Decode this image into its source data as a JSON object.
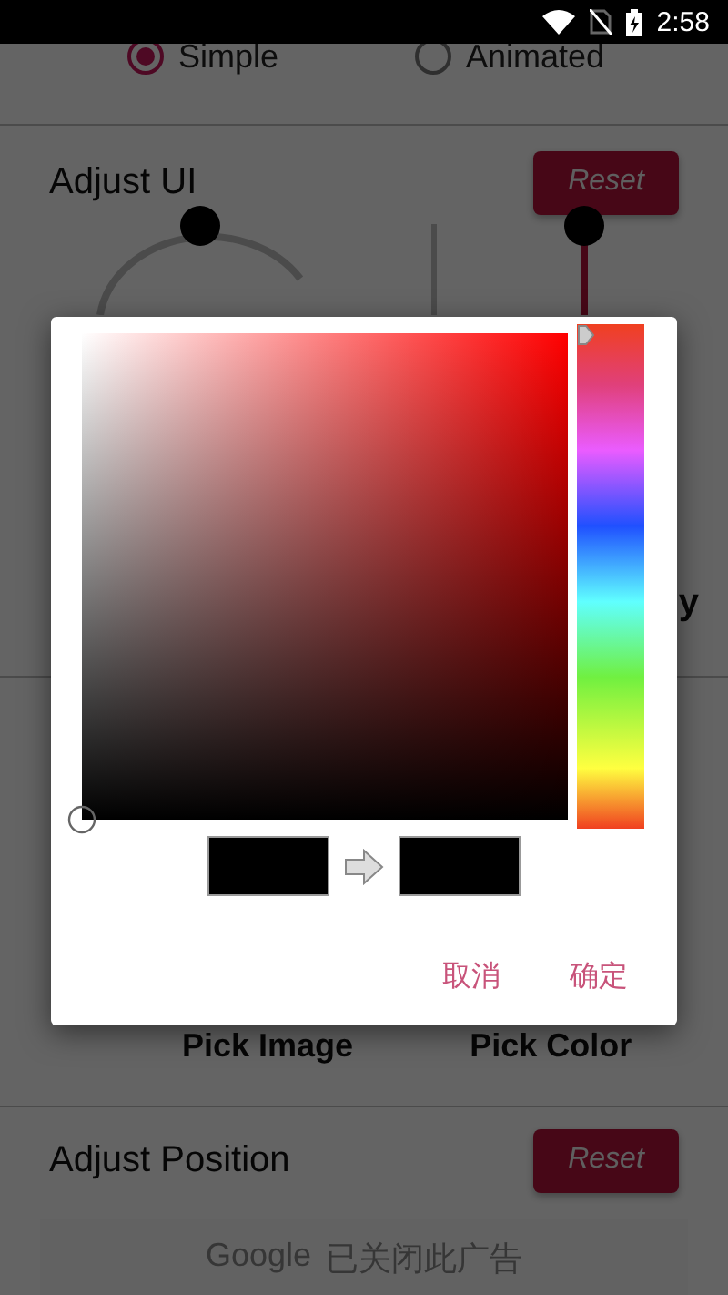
{
  "status_bar": {
    "time": "2:58"
  },
  "mode_options": [
    {
      "label": "Simple",
      "selected": true
    },
    {
      "label": "Animated",
      "selected": false
    }
  ],
  "adjust_ui": {
    "title": "Adjust UI",
    "reset_label": "Reset",
    "side_label_fragment": "y"
  },
  "pick_buttons": [
    {
      "label": "Pick Image"
    },
    {
      "label": "Pick Color"
    }
  ],
  "adjust_position": {
    "title": "Adjust Position",
    "reset_label": "Reset"
  },
  "ad_banner": {
    "brand": "Google",
    "message": "已关闭此广告"
  },
  "color_dialog": {
    "hue_slider": {
      "level": 0
    },
    "swatches": [
      {
        "color": "#000000"
      },
      {
        "color": "#000000"
      }
    ],
    "buttons": [
      "取消",
      "确定"
    ]
  }
}
